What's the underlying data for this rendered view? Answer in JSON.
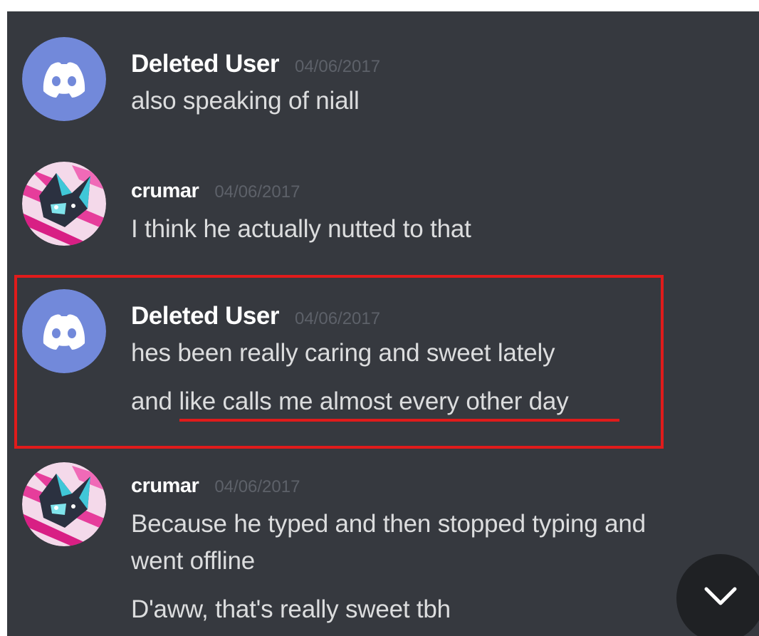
{
  "messages": [
    {
      "username": "Deleted User",
      "timestamp": "04/06/2017",
      "avatar": "discord-default-avatar",
      "lines": [
        "also speaking of niall"
      ]
    },
    {
      "username": "crumar",
      "timestamp": "04/06/2017",
      "avatar": "pink-cat-avatar",
      "lines": [
        "I think he actually nutted to that"
      ]
    },
    {
      "username": "Deleted User",
      "timestamp": "04/06/2017",
      "avatar": "discord-default-avatar",
      "lines": [
        "hes been really caring and sweet lately",
        "and like calls me almost every other day"
      ],
      "highlighted": true,
      "underlined_text": "like calls me almost every other day"
    },
    {
      "username": "crumar",
      "timestamp": "04/06/2017",
      "avatar": "pink-cat-avatar",
      "lines": [
        "Because he typed and then stopped typing and",
        "went offline",
        "D'aww, that's really sweet tbh"
      ]
    }
  ],
  "scroll_button_icon": "chevron-down-icon",
  "colors": {
    "background": "#36393f",
    "blurple": "#7289da",
    "highlight": "#e01b1b",
    "username": "#ffffff",
    "message_text": "#dcddde",
    "timestamp": "#5d6169"
  }
}
